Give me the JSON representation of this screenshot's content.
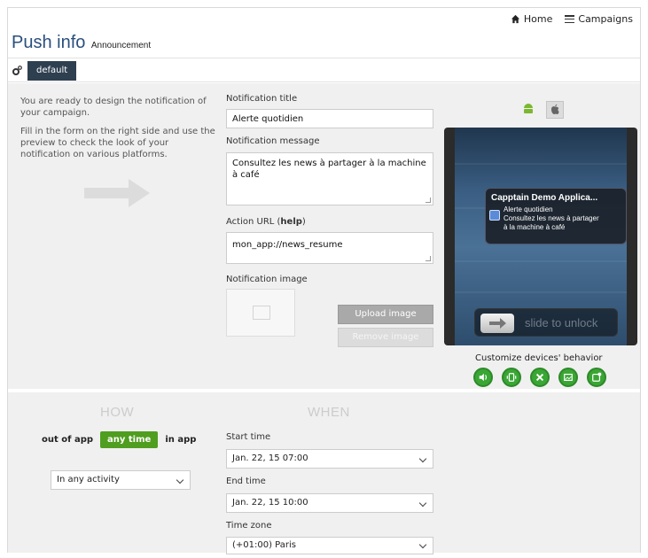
{
  "nav": {
    "home_label": "Home",
    "campaigns_label": "Campaigns"
  },
  "header": {
    "title": "Push info",
    "subtitle": "Announcement"
  },
  "tabs": {
    "active_label": "default"
  },
  "intro": {
    "line1": "You are ready to design the notification of your campaign.",
    "line2": "Fill in the form on the right side and use the preview to check the look of your notification on various platforms."
  },
  "form": {
    "title_label": "Notification title",
    "title_value": "Alerte quotidien",
    "message_label": "Notification message",
    "message_value": "Consultez les news à partager à la machine à café",
    "action_label": "Action URL (",
    "action_help": "help",
    "action_close": ")",
    "action_value": "mon_app://news_resume",
    "image_label": "Notification image",
    "upload_label": "Upload image",
    "remove_label": "Remove image"
  },
  "preview": {
    "app_name": "Capptain Demo Applica...",
    "notif_title": "Alerte quotidien",
    "notif_line1": "Consultez les news à partager",
    "notif_line2": "à la machine à café",
    "slide_text": "slide to unlock",
    "customize_label": "Customize devices' behavior"
  },
  "how": {
    "heading": "HOW",
    "out_label": "out of app",
    "any_label": "any time",
    "in_label": "in app",
    "activity_value": "In any activity"
  },
  "when": {
    "heading": "WHEN",
    "start_label": "Start time",
    "start_value": "Jan. 22, 15 07:00",
    "end_label": "End time",
    "end_value": "Jan. 22, 15 10:00",
    "tz_label": "Time zone",
    "tz_value": "(+01:00) Paris"
  },
  "colors": {
    "accent_green": "#4f9e1f",
    "tab_dark": "#2e3f50",
    "title_blue": "#2a4f7c"
  }
}
